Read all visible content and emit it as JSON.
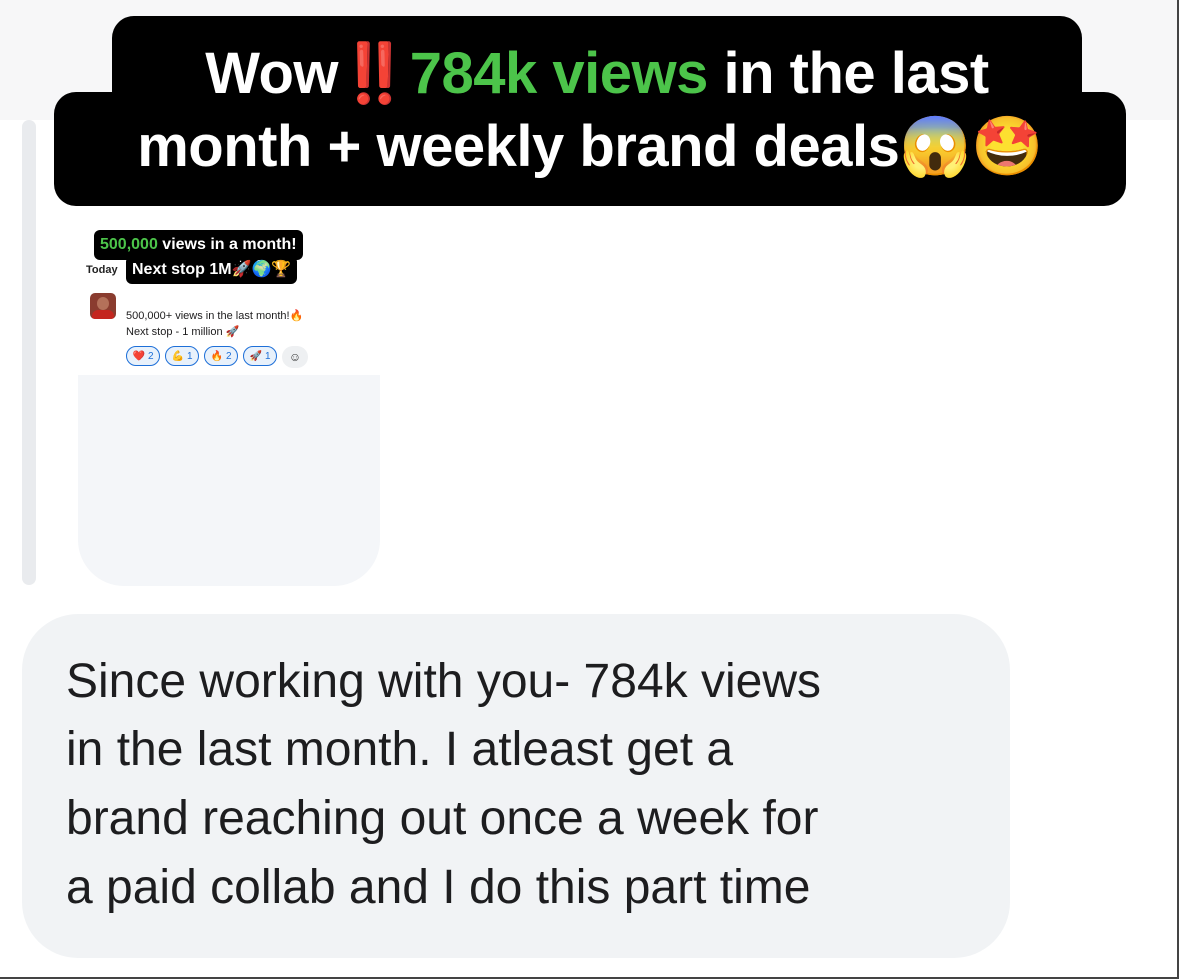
{
  "headline": {
    "line1_prefix": "Wow",
    "line1_emph": "‼️",
    "line1_green": "784k views",
    "line1_suffix": "in the last",
    "line2": "month + weekly brand deals😱🤩"
  },
  "screenshot": {
    "caption_green": "500,000",
    "caption_rest": "views in a month!",
    "today_label": "Today",
    "caption_line2": "Next stop 1M🚀🌍🏆",
    "message_line1": "500,000+ views in the last month!🔥",
    "message_line2": "Next stop - 1 million 🚀",
    "reactions": [
      {
        "emoji": "❤️",
        "count": "2"
      },
      {
        "emoji": "💪",
        "count": "1"
      },
      {
        "emoji": "🔥",
        "count": "2"
      },
      {
        "emoji": "🚀",
        "count": "1"
      }
    ],
    "add_reaction_icon": "add-reaction-icon"
  },
  "message": {
    "lines": [
      "Since working with you- 784k views",
      "in the last month. I atleast get a",
      "brand reaching out once a week for",
      "a paid collab and I do this part time"
    ]
  },
  "colors": {
    "accent_green": "#4cc44a",
    "bubble_bg": "#f1f3f5",
    "reaction_blue": "#1d6fd8"
  }
}
